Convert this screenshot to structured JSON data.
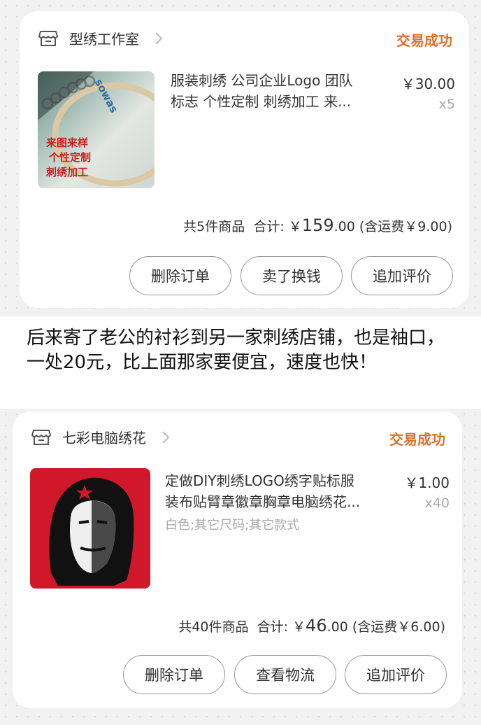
{
  "orders": [
    {
      "store_name": "型绣工作室",
      "status": "交易成功",
      "title_line1": "服装刺绣 公司企业Logo 团队",
      "title_line2": "标志 个性定制 刺绣加工 来...",
      "price": "￥30.00",
      "quantity": "x5",
      "thumb_text": [
        "来图来样",
        "个性定制",
        "刺绣加工"
      ],
      "thumb_brand": "sowas",
      "summary_count": "共5件商品",
      "summary_label": "合计: ￥",
      "summary_amount": "159",
      "summary_cents": ".00",
      "summary_shipping": "(含运费￥9.00)",
      "buttons": [
        "删除订单",
        "卖了换钱",
        "追加评价"
      ]
    },
    {
      "store_name": "七彩电脑绣花",
      "status": "交易成功",
      "title_line1": "定做DIY刺绣LOGO绣字贴标服",
      "title_line2": "装布贴臂章徽章胸章电脑绣花...",
      "spec": "白色;其它尺码;其它款式",
      "price": "￥1.00",
      "quantity": "x40",
      "summary_count": "共40件商品",
      "summary_label": "合计: ￥",
      "summary_amount": "46",
      "summary_cents": ".00",
      "summary_shipping": "(含运费￥6.00)",
      "buttons": [
        "删除订单",
        "查看物流",
        "追加评价"
      ]
    }
  ],
  "middle_text": "后来寄了老公的衬衫到另一家刺绣店铺，也是袖口，一处20元，比上面那家要便宜，速度也快！",
  "colors": {
    "status": "#e0702a",
    "background_band": "#f1f1f1",
    "thumb2_red": "#d0182a"
  }
}
